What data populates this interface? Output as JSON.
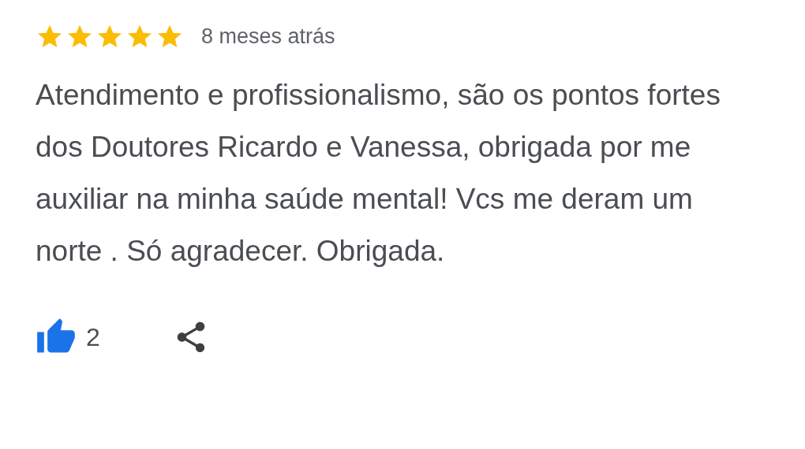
{
  "review": {
    "stars": 5,
    "time": "8 meses atrás",
    "text": "Atendimento e profissionalismo, são os pontos fortes dos Doutores Ricardo e Vanessa, obrigada por me auxiliar na minha saúde mental! Vcs me deram um norte . Só agradecer. Obrigada."
  },
  "actions": {
    "liked": true,
    "like_count": "2"
  }
}
